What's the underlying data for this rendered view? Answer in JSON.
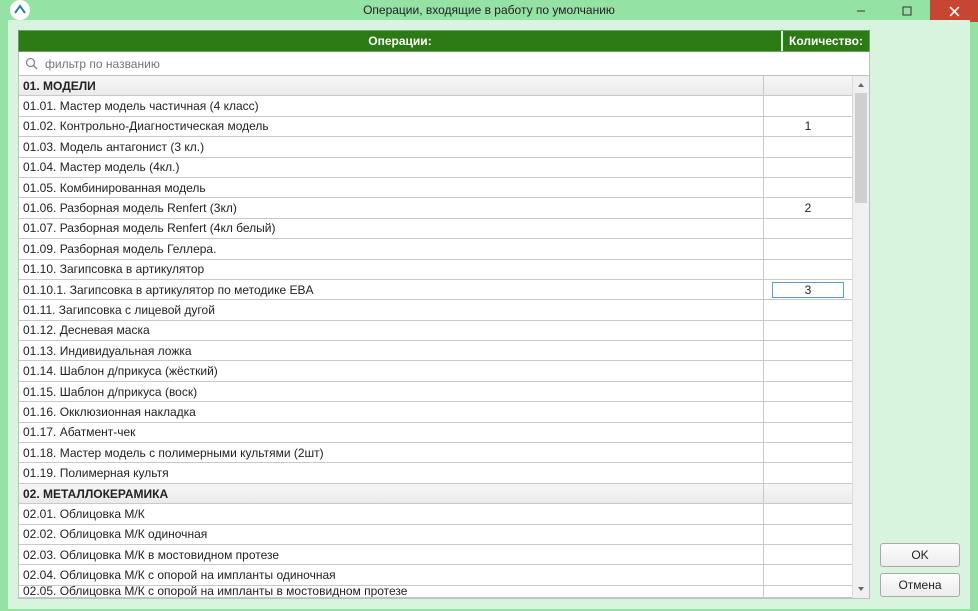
{
  "window": {
    "title": "Операции, входящие в работу по умолчанию"
  },
  "columns": {
    "operations": "Операции:",
    "quantity": "Количество:"
  },
  "filter": {
    "placeholder": "фильтр по названию",
    "value": ""
  },
  "buttons": {
    "ok": "OK",
    "cancel": "Отмена"
  },
  "rows": [
    {
      "type": "group",
      "label": "01. МОДЕЛИ"
    },
    {
      "type": "item",
      "label": "01.01. Мастер модель частичная (4 класс)",
      "qty": ""
    },
    {
      "type": "item",
      "label": "01.02. Контрольно-Диагностическая модель",
      "qty": "1"
    },
    {
      "type": "item",
      "label": "01.03. Модель антагонист (3 кл.)",
      "qty": ""
    },
    {
      "type": "item",
      "label": "01.04. Мастер модель (4кл.)",
      "qty": ""
    },
    {
      "type": "item",
      "label": "01.05. Комбинированная модель",
      "qty": ""
    },
    {
      "type": "item",
      "label": "01.06. Разборная модель Renfert (3кл)",
      "qty": "2"
    },
    {
      "type": "item",
      "label": "01.07. Разборная модель Renfert (4кл белый)",
      "qty": ""
    },
    {
      "type": "item",
      "label": "01.09. Разборная модель Геллера.",
      "qty": ""
    },
    {
      "type": "item",
      "label": "01.10. Загипсовка в артикулятор",
      "qty": ""
    },
    {
      "type": "item",
      "label": "01.10.1. Загипсовка в артикулятор по методике EBA",
      "qty": "3",
      "editing": true
    },
    {
      "type": "item",
      "label": "01.11. Загипсовка с лицевой дугой",
      "qty": ""
    },
    {
      "type": "item",
      "label": "01.12. Десневая маска",
      "qty": ""
    },
    {
      "type": "item",
      "label": "01.13. Индивидуальная ложка",
      "qty": ""
    },
    {
      "type": "item",
      "label": "01.14. Шаблон д/прикуса (жёсткий)",
      "qty": ""
    },
    {
      "type": "item",
      "label": "01.15. Шаблон д/прикуса (воск)",
      "qty": ""
    },
    {
      "type": "item",
      "label": "01.16. Окклюзионная накладка",
      "qty": ""
    },
    {
      "type": "item",
      "label": "01.17. Абатмент-чек",
      "qty": ""
    },
    {
      "type": "item",
      "label": "01.18. Мастер модель с полимерными культями (2шт)",
      "qty": ""
    },
    {
      "type": "item",
      "label": "01.19. Полимерная культя",
      "qty": ""
    },
    {
      "type": "group",
      "label": "02. МЕТАЛЛОКЕРАМИКА"
    },
    {
      "type": "item",
      "label": "02.01. Облицовка М/К",
      "qty": ""
    },
    {
      "type": "item",
      "label": "02.02. Облицовка М/К одиночная",
      "qty": ""
    },
    {
      "type": "item",
      "label": "02.03. Облицовка М/К в мостовидном протезе",
      "qty": ""
    },
    {
      "type": "item",
      "label": "02.04. Облицовка М/К с опорой на импланты одиночная",
      "qty": ""
    },
    {
      "type": "item",
      "label": "02.05. Облицовка М/К с опорой на импланты в мостовидном протезе",
      "qty": "",
      "cutoff": true
    }
  ]
}
